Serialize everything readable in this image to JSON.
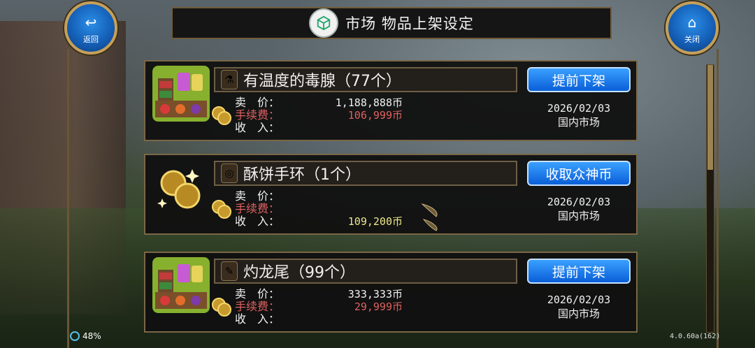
{
  "header": {
    "title": "市场  物品上架设定",
    "icon": "market-cube-icon"
  },
  "back_button": {
    "label": "返回",
    "icon": "back-arrow-icon"
  },
  "close_button": {
    "label": "关闭",
    "icon": "home-icon"
  },
  "items": [
    {
      "name": "有温度的毒腺（77个）",
      "item_icon": "potion-flask-icon",
      "big_icon": "market-stall-icon",
      "price_label": "卖　价：",
      "price_value": "1,188,888币",
      "fee_label": "手续费：",
      "fee_value": "106,999币",
      "income_label": "收　入：",
      "income_value": "",
      "action": "提前下架",
      "date": "2026/02/03",
      "market": "国内市场"
    },
    {
      "name": "酥饼手环（1个）",
      "item_icon": "bracelet-icon",
      "big_icon": "gold-coins-icon",
      "price_label": "卖　价：",
      "price_value": "",
      "fee_label": "手续费：",
      "fee_value": "",
      "income_label": "收　入：",
      "income_value": "109,200币",
      "action": "收取众神币",
      "date": "2026/02/03",
      "market": "国内市场"
    },
    {
      "name": "灼龙尾（99个）",
      "item_icon": "dragon-tail-icon",
      "big_icon": "market-stall-icon",
      "price_label": "卖　价：",
      "price_value": "333,333币",
      "fee_label": "手续费：",
      "fee_value": "29,999币",
      "income_label": "收　入：",
      "income_value": "",
      "action": "提前下架",
      "date": "2026/02/03",
      "market": "国内市场"
    }
  ],
  "status": {
    "battery": "48%"
  },
  "version": "4.0.60a(162)",
  "colors": {
    "button_blue": "#0a5fd8",
    "fee_red": "#e06060",
    "income_yellow": "#f0e78b",
    "frame_gold": "#7a6747"
  }
}
